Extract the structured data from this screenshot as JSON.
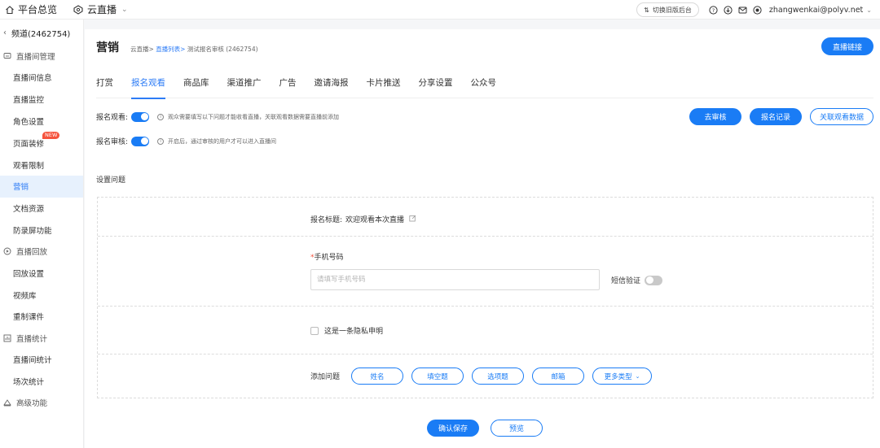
{
  "topbar": {
    "home_label": "平台总览",
    "product_label": "云直播",
    "switch_label": "切换旧版后台",
    "user_email": "zhangwenkai@polyv.net"
  },
  "sidebar": {
    "back_label": "频道(2462754)",
    "groups": [
      {
        "label": "直播间管理",
        "icon": "monitor-icon",
        "items": [
          "直播间信息",
          "直播监控",
          "角色设置",
          "页面装修",
          "观看限制",
          "营销",
          "文档资源",
          "防录屏功能"
        ]
      },
      {
        "label": "直播回放",
        "icon": "play-circle-icon",
        "items": [
          "回放设置",
          "视频库",
          "重制课件"
        ]
      },
      {
        "label": "直播统计",
        "icon": "bar-chart-icon",
        "items": [
          "直播间统计",
          "场次统计"
        ]
      },
      {
        "label": "高级功能",
        "icon": "advanced-icon",
        "items": []
      }
    ],
    "new_badge": "NEW",
    "active_item": "营销"
  },
  "header": {
    "title": "营销",
    "breadcrumb": {
      "root": "云直播>",
      "link": "直播列表>",
      "current": "测试报名审核 (2462754)"
    },
    "live_link_button": "直播链接"
  },
  "tabs": [
    "打赏",
    "报名观看",
    "商品库",
    "渠道推广",
    "广告",
    "邀请海报",
    "卡片推送",
    "分享设置",
    "公众号"
  ],
  "active_tab": "报名观看",
  "settings": {
    "signup_label": "报名观看:",
    "signup_hint": "观众需要填写以下问题才能收看直播，关联观看数据需要直播前添加",
    "review_label": "报名审核:",
    "review_hint": "开启后，通过审核的用户才可以进入直播间"
  },
  "actions": {
    "review": "去审核",
    "records": "报名记录",
    "link_data": "关联观看数据"
  },
  "section": {
    "label": "设置问题"
  },
  "form": {
    "title_label": "报名标题:",
    "title_value": "欢迎观看本次直播",
    "phone_label": "手机号码",
    "phone_placeholder": "请填写手机号码",
    "sms_label": "短信验证",
    "privacy_label": "这是一条隐私申明",
    "add_question_label": "添加问题",
    "question_types": [
      "姓名",
      "填空题",
      "选项题",
      "邮箱"
    ],
    "more_types": "更多类型"
  },
  "footer": {
    "save": "确认保存",
    "preview": "预览"
  },
  "colors": {
    "accent": "#1a7cf5",
    "active_bg": "#e7f1fd",
    "badge": "#f5533d"
  }
}
